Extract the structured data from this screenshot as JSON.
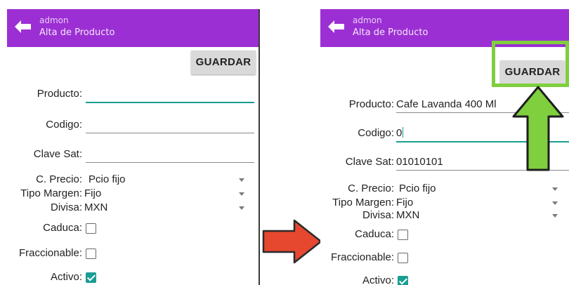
{
  "colors": {
    "appbar": "#9c2fd3",
    "accent": "#1a9e93",
    "arrow_red": "#e5482f",
    "arrow_green": "#7fcf3e"
  },
  "icons": {
    "back": "arrow-left-icon",
    "transition": "arrow-right-icon",
    "pointer": "arrow-up-icon"
  },
  "before": {
    "appbar": {
      "user": "admon",
      "title": "Alta de Producto"
    },
    "save_label": "GUARDAR",
    "producto_label": "Producto:",
    "producto_value": "",
    "codigo_label": "Codigo:",
    "codigo_value": "",
    "clave_label": "Clave Sat:",
    "clave_value": "",
    "precio_label": "C. Precio:",
    "precio_value": "Pcio fijo",
    "margen_label": "Tipo Margen:",
    "margen_value": "Fijo",
    "divisa_label": "Divisa:",
    "divisa_value": "MXN",
    "caduca_label": "Caduca:",
    "caduca_checked": false,
    "fracc_label": "Fraccionable:",
    "fracc_checked": false,
    "activo_label": "Activo:",
    "activo_checked": true
  },
  "after": {
    "appbar": {
      "user": "admon",
      "title": "Alta de Producto"
    },
    "save_label": "GUARDAR",
    "producto_label": "Producto:",
    "producto_value": "Cafe Lavanda 400 Ml",
    "codigo_label": "Codigo:",
    "codigo_value": "0",
    "clave_label": "Clave Sat:",
    "clave_value": "01010101",
    "precio_label": "C. Precio:",
    "precio_value": "Pcio fijo",
    "margen_label": "Tipo Margen:",
    "margen_value": "Fijo",
    "divisa_label": "Divisa:",
    "divisa_value": "MXN",
    "caduca_label": "Caduca:",
    "caduca_checked": false,
    "fracc_label": "Fraccionable:",
    "fracc_checked": false,
    "activo_label": "Activo:",
    "activo_checked": true
  }
}
